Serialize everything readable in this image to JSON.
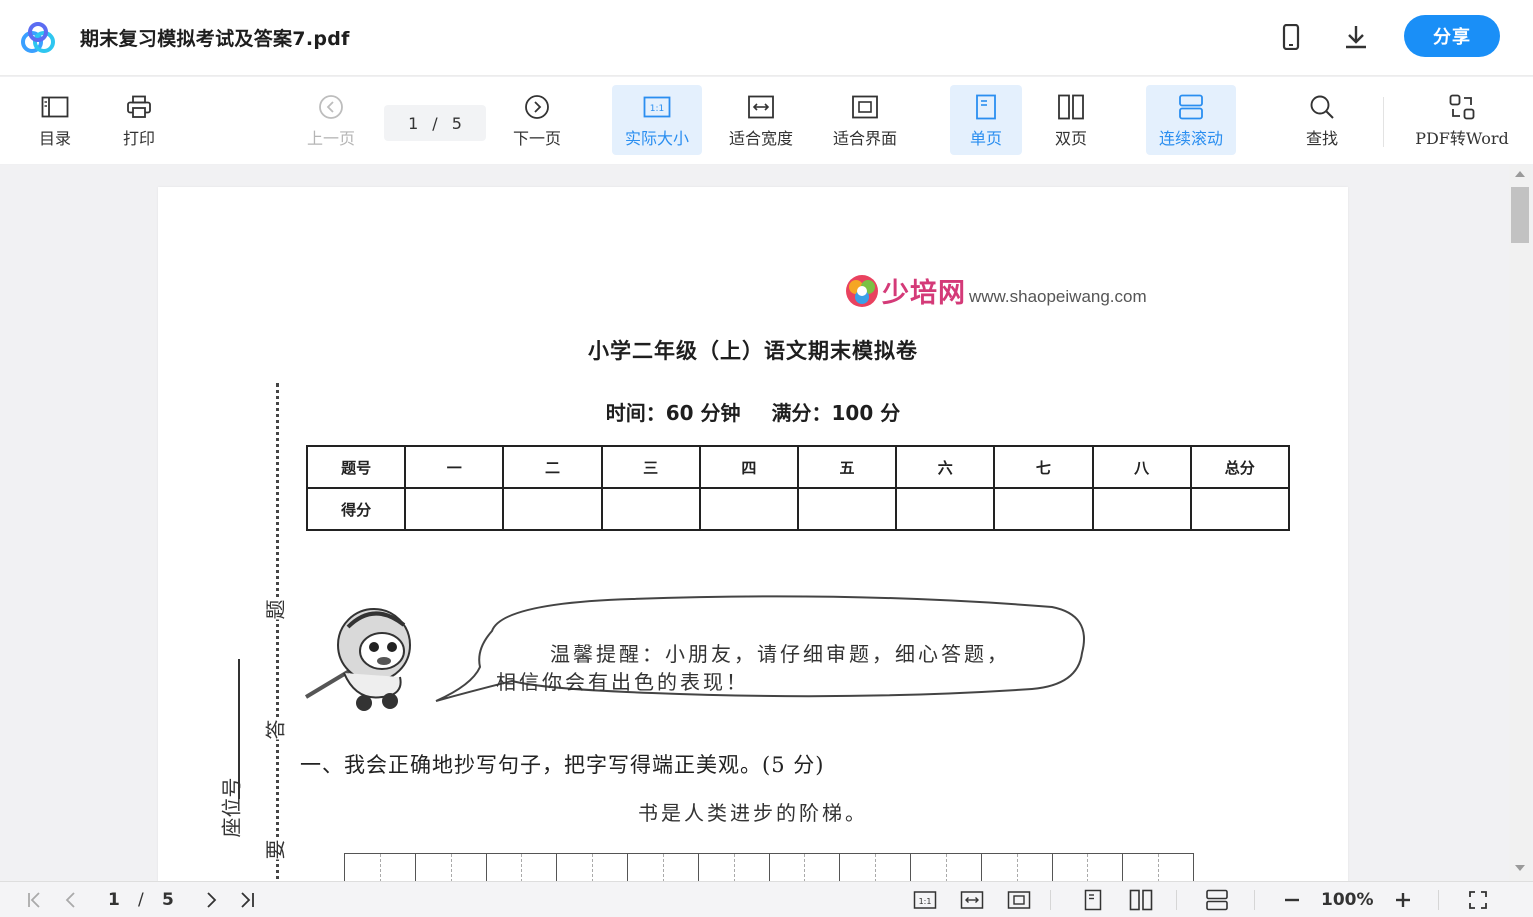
{
  "header": {
    "title": "期末复习模拟考试及答案7.pdf",
    "share_label": "分享",
    "icons": [
      "app-logo",
      "mobile-icon",
      "download-icon"
    ]
  },
  "toolbar": {
    "toc": "目录",
    "print": "打印",
    "prev": "上一页",
    "page_current": "1",
    "page_sep": "/",
    "page_total": "5",
    "next": "下一页",
    "actual_size": "实际大小",
    "fit_width": "适合宽度",
    "fit_page": "适合界面",
    "single_page": "单页",
    "double_page": "双页",
    "continuous_scroll": "连续滚动",
    "find": "查找",
    "pdf_to_word": "PDF转Word",
    "accent_color": "#2a8ef0"
  },
  "document": {
    "brand_name": "少培网",
    "brand_url": "www.shaopeiwang.com",
    "exam_title": "小学二年级（上）语文期末模拟卷",
    "time_label": "时间：60 分钟",
    "score_label": "满分：100 分",
    "table": {
      "header_row": [
        "题号",
        "一",
        "二",
        "三",
        "四",
        "五",
        "六",
        "七",
        "八",
        "总分"
      ],
      "score_row": [
        "得分",
        "",
        "",
        "",
        "",
        "",
        "",
        "",
        "",
        ""
      ]
    },
    "margin_chars": [
      "题",
      "答",
      "要"
    ],
    "seat_label": "座位号",
    "reminder_line1": "温馨提醒：小朋友，请仔细审题，细心答题，",
    "reminder_line2": "相信你会有出色的表现！",
    "section1_title": "一、我会正确地抄写句子，把字写得端正美观。(5 分)",
    "section1_sentence": "书是人类进步的阶梯。"
  },
  "bottombar": {
    "page_current": "1",
    "page_sep": "/",
    "page_total": "5",
    "zoom": "100%"
  }
}
